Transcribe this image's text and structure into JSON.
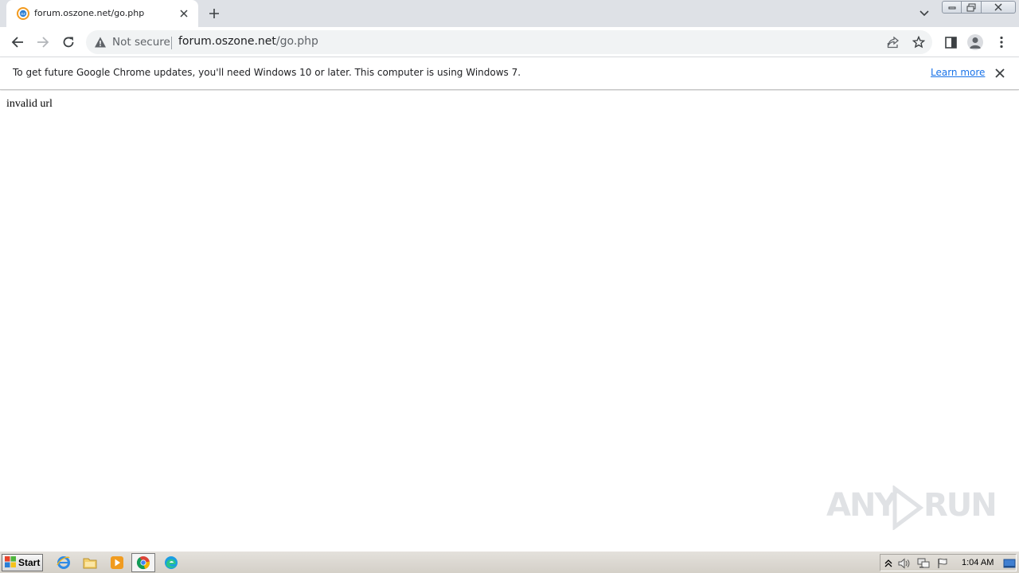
{
  "browser": {
    "tab": {
      "title": "forum.oszone.net/go.php",
      "favicon": "oszone-favicon-icon"
    },
    "new_tab_icon": "plus-icon",
    "tab_search_icon": "chevron-down-icon",
    "window_controls": [
      "minimize-icon",
      "restore-icon",
      "close-icon"
    ]
  },
  "toolbar": {
    "security_label": "Not secure",
    "url_host": "forum.oszone.net",
    "url_path": "/go.php",
    "icons": [
      "back-icon",
      "forward-icon",
      "reload-icon",
      "share-icon",
      "star-icon",
      "side-panel-icon",
      "profile-icon",
      "menu-icon"
    ]
  },
  "infobar": {
    "message": "To get future Google Chrome updates, you'll need Windows 10 or later. This computer is using Windows 7.",
    "link_label": "Learn more"
  },
  "page": {
    "body_text": "invalid url"
  },
  "watermark": {
    "left": "ANY",
    "right": "RUN"
  },
  "taskbar": {
    "start_label": "Start",
    "apps": [
      "internet-explorer-icon",
      "folder-icon",
      "media-player-icon",
      "chrome-icon",
      "edge-icon"
    ],
    "clock": "1:04 AM"
  }
}
